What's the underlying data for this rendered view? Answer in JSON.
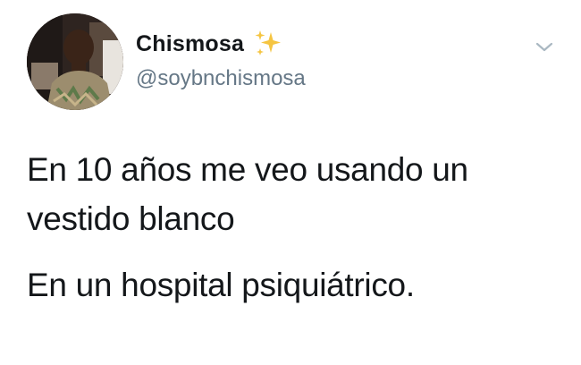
{
  "tweet": {
    "display_name": "Chismosa",
    "handle": "@soybnchismosa",
    "paragraphs": [
      "En 10 años me veo usando un vestido blanco",
      "En un hospital psiquiátrico."
    ]
  },
  "icons": {
    "name_emoji": "sparkles-icon",
    "menu": "chevron-down-icon",
    "avatar": "profile-photo"
  },
  "colors": {
    "text": "#14171a",
    "secondary_text": "#657786",
    "sparkle": "#f5c542",
    "chevron": "#aab8c2"
  }
}
